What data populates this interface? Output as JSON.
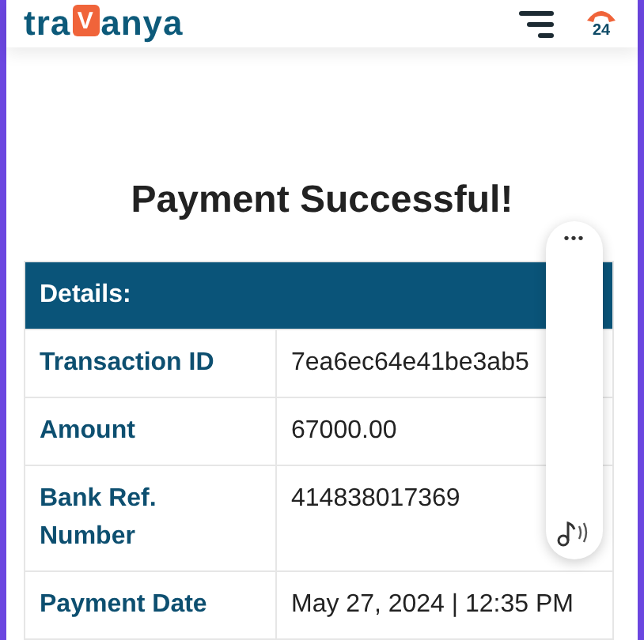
{
  "header": {
    "logo": {
      "before": "tra",
      "badge": "V",
      "after": "anya"
    },
    "support_badge": "24"
  },
  "title": "Payment Successful!",
  "table": {
    "heading": "Details:",
    "rows": [
      {
        "label": "Transaction ID",
        "value": "7ea6ec64e41be3ab5"
      },
      {
        "label": "Amount",
        "value": "67000.00"
      },
      {
        "label": "Bank Ref. Number",
        "value": "414838017369"
      },
      {
        "label": "Payment Date",
        "value": "May 27, 2024 | 12:35 PM"
      }
    ]
  },
  "overlay": {
    "menu": "•••"
  }
}
